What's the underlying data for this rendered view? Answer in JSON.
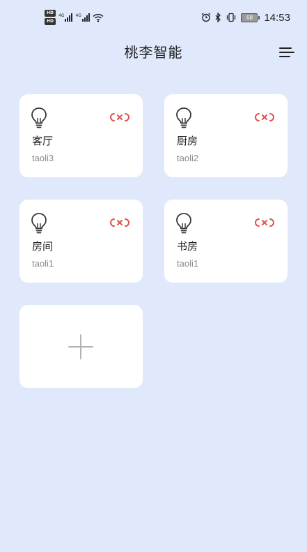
{
  "status_bar": {
    "hd_badge_1": "HD",
    "hd_badge_2": "HD",
    "net_1": "4G",
    "net_2": "4G",
    "battery_level": "68",
    "time": "14:53"
  },
  "header": {
    "title": "桃李智能",
    "menu_icon": "menu-icon"
  },
  "devices": [
    {
      "room": "客厅",
      "device_id": "taoli3",
      "icon": "bulb-icon",
      "status_icon": "link-broken-icon",
      "status_color": "#e0504a"
    },
    {
      "room": "厨房",
      "device_id": "taoli2",
      "icon": "bulb-icon",
      "status_icon": "link-broken-icon",
      "status_color": "#e0504a"
    },
    {
      "room": "房间",
      "device_id": "taoli1",
      "icon": "bulb-icon",
      "status_icon": "link-broken-icon",
      "status_color": "#e0504a"
    },
    {
      "room": "书房",
      "device_id": "taoli1",
      "icon": "bulb-icon",
      "status_icon": "link-broken-icon",
      "status_color": "#e0504a"
    }
  ],
  "add_card": {
    "icon": "plus-icon"
  },
  "colors": {
    "background": "#dfe9fb",
    "card": "#ffffff",
    "offline_accent": "#e0504a"
  }
}
